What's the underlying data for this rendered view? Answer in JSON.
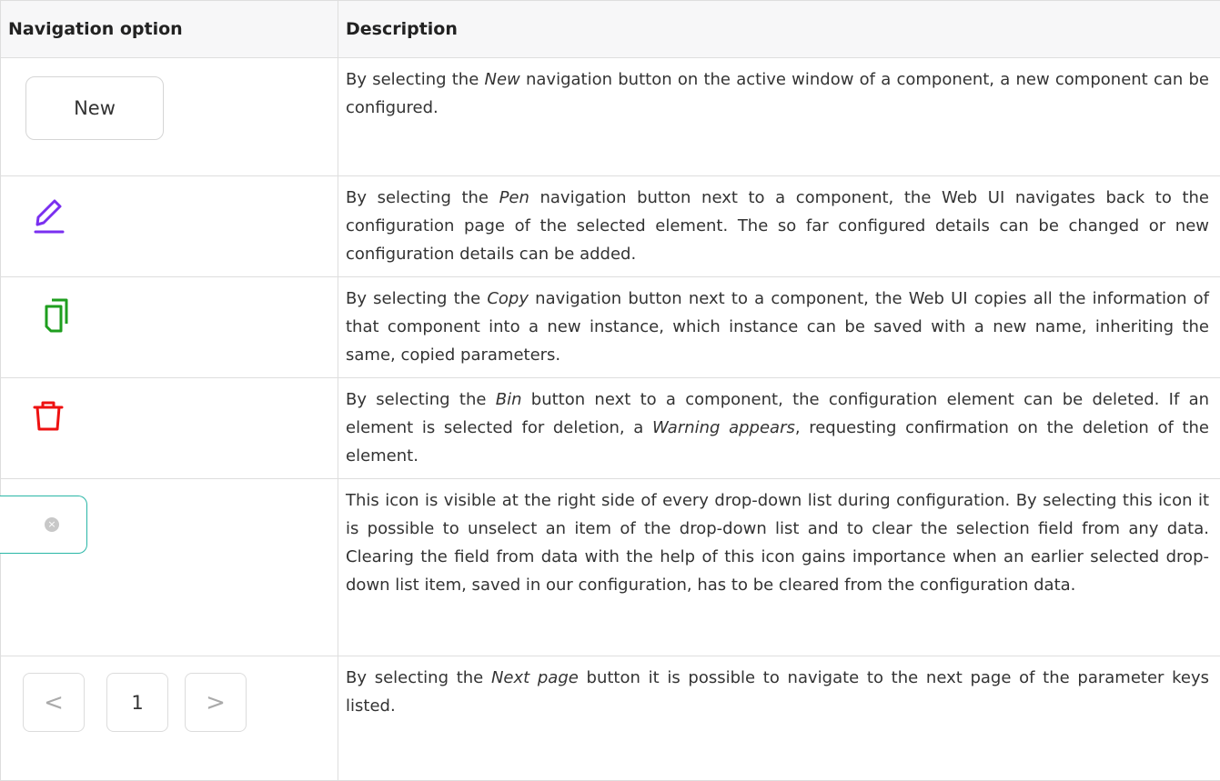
{
  "table": {
    "headers": [
      "Navigation option",
      "Description"
    ],
    "rows": [
      {
        "option_label": "New",
        "description": [
          {
            "text": "By selecting the "
          },
          {
            "text": "New",
            "em": true
          },
          {
            "text": " navigation button on the active window of a component, a new component can be configured."
          }
        ]
      },
      {
        "option_icon": "pen-icon",
        "description": [
          {
            "text": "By selecting the "
          },
          {
            "text": "Pen",
            "em": true
          },
          {
            "text": " navigation button next to a component, the Web UI navigates back to the configuration page of the selected element. The so far configured details can be changed or new configuration details can be added."
          }
        ]
      },
      {
        "option_icon": "copy-icon",
        "description": [
          {
            "text": "By selecting the "
          },
          {
            "text": "Copy",
            "em": true
          },
          {
            "text": " navigation button next to a component, the Web UI copies all the information of that component into a new instance, which instance can be saved with a new name, inheriting the same, copied parameters."
          }
        ]
      },
      {
        "option_icon": "bin-icon",
        "description": [
          {
            "text": "By selecting the "
          },
          {
            "text": "Bin",
            "em": true
          },
          {
            "text": " button next to a component, the configuration element can be deleted. If an element is selected for deletion, a "
          },
          {
            "text": "Warning appears",
            "em": true
          },
          {
            "text": ", requesting confirmation on the deletion of the element."
          }
        ]
      },
      {
        "option_icon": "clear-selection-icon",
        "description": [
          {
            "text": "This icon is visible at the right side of every drop-down list during configuration. By selecting this icon it is possible to unselect an item of the drop-down list and to clear the selection field from any data. Clearing the field from data with the help of this icon gains importance when an earlier selected drop-down list item, saved in our configuration, has to be cleared from the configuration data."
          }
        ]
      },
      {
        "pager": {
          "prev": "<",
          "page": "1",
          "next": ">"
        },
        "description": [
          {
            "text": "By selecting the "
          },
          {
            "text": "Next page",
            "em": true
          },
          {
            "text": " button it is possible to navigate to the next page of the parameter keys listed."
          }
        ]
      }
    ]
  },
  "colors": {
    "pen": "#7a2ff0",
    "copy": "#1e9e1e",
    "bin": "#ee1111",
    "clear_border": "#29b6a6"
  }
}
